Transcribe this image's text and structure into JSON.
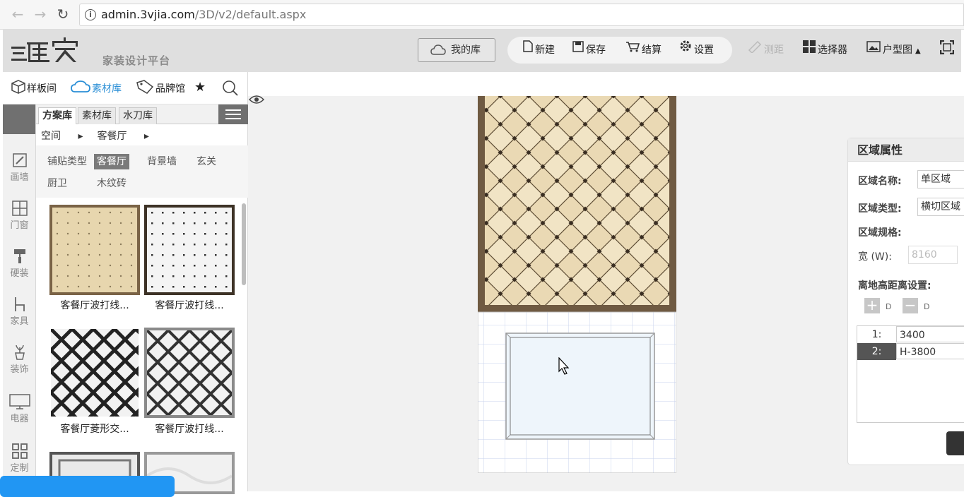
{
  "browser": {
    "url_host": "admin.3vjia.com",
    "url_path": "/3D/v2/default.aspx",
    "back_icon": "arrow-left-icon",
    "forward_icon": "arrow-right-icon",
    "reload_icon": "reload-icon"
  },
  "header": {
    "logo_text": "三维家",
    "subtitle": "家装设计平台",
    "my_library": "我的库",
    "actions": [
      "新建",
      "保存",
      "结算",
      "设置"
    ],
    "tools": [
      "测距",
      "选择器",
      "户型图"
    ],
    "accent_color": "#2b8fd6"
  },
  "left": {
    "top_tabs": [
      "样板间",
      "素材库",
      "品牌馆"
    ],
    "side_nav": [
      "画墙",
      "门窗",
      "硬装",
      "家具",
      "装饰",
      "电器",
      "定制"
    ],
    "sub_tabs": [
      "方案库",
      "素材库",
      "水刀库"
    ],
    "breadcrumb": [
      "空间",
      "客餐厅"
    ],
    "filter_label": "铺贴类型",
    "filters": [
      "客餐厅",
      "背景墙",
      "玄关",
      "厨卫",
      "木纹砖"
    ],
    "items": [
      {
        "caption": "客餐厅波打线..."
      },
      {
        "caption": "客餐厅波打线..."
      },
      {
        "caption": "客餐厅菱形交..."
      },
      {
        "caption": "客餐厅波打线..."
      }
    ]
  },
  "props": {
    "title": "区域属性",
    "name_label": "区域名称:",
    "name_value": "单区域",
    "type_label": "区域类型:",
    "type_value": "横切区域",
    "spec_label": "区域规格:",
    "width_label": "宽 (W):",
    "width_value": "8160",
    "height_label": "离地高距离设置:",
    "add_sub": "D",
    "remove_sub": "D",
    "rows": [
      {
        "index": "1:",
        "value": "3400"
      },
      {
        "index": "2:",
        "value": "H-3800"
      }
    ]
  }
}
